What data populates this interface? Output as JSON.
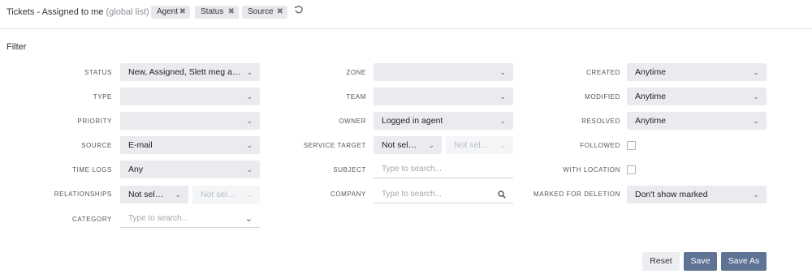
{
  "header": {
    "title": "Tickets - Assigned to me",
    "subtitle": "(global list)",
    "chips": [
      "Agent",
      "Status",
      "Source"
    ],
    "chip_remove_glyph": "✖",
    "refresh_icon": "refresh-icon"
  },
  "filter": {
    "title": "Filter",
    "status": {
      "label": "STATUS",
      "value": "New, Assigned, Slett meg a…"
    },
    "type": {
      "label": "TYPE",
      "value": ""
    },
    "priority": {
      "label": "PRIORITY",
      "value": ""
    },
    "source": {
      "label": "SOURCE",
      "value": "E-mail"
    },
    "time_logs": {
      "label": "TIME LOGS",
      "value": "Any"
    },
    "relationships": {
      "label": "RELATIONSHIPS",
      "value": "Not sel…",
      "secondary": "Not sel…"
    },
    "category": {
      "label": "CATEGORY",
      "placeholder": "Type to search..."
    },
    "zone": {
      "label": "ZONE",
      "value": ""
    },
    "team": {
      "label": "TEAM",
      "value": ""
    },
    "owner": {
      "label": "OWNER",
      "value": "Logged in agent"
    },
    "service_target": {
      "label": "SERVICE TARGET",
      "value": "Not sel…",
      "secondary": "Not sel…"
    },
    "subject": {
      "label": "SUBJECT",
      "placeholder": "Type to search..."
    },
    "company": {
      "label": "COMPANY",
      "placeholder": "Type to search..."
    },
    "created": {
      "label": "CREATED",
      "value": "Anytime"
    },
    "modified": {
      "label": "MODIFIED",
      "value": "Anytime"
    },
    "resolved": {
      "label": "RESOLVED",
      "value": "Anytime"
    },
    "followed": {
      "label": "FOLLOWED",
      "checked": false
    },
    "with_location": {
      "label": "WITH LOCATION",
      "checked": false
    },
    "marked_for_deletion": {
      "label": "MARKED FOR DELETION",
      "value": "Don't show marked"
    }
  },
  "buttons": {
    "reset": "Reset",
    "save": "Save",
    "save_as": "Save As"
  },
  "colors": {
    "primary_button": "#5f7395",
    "select_bg": "#e9ebee",
    "chip_bg": "#e6e8eb"
  }
}
